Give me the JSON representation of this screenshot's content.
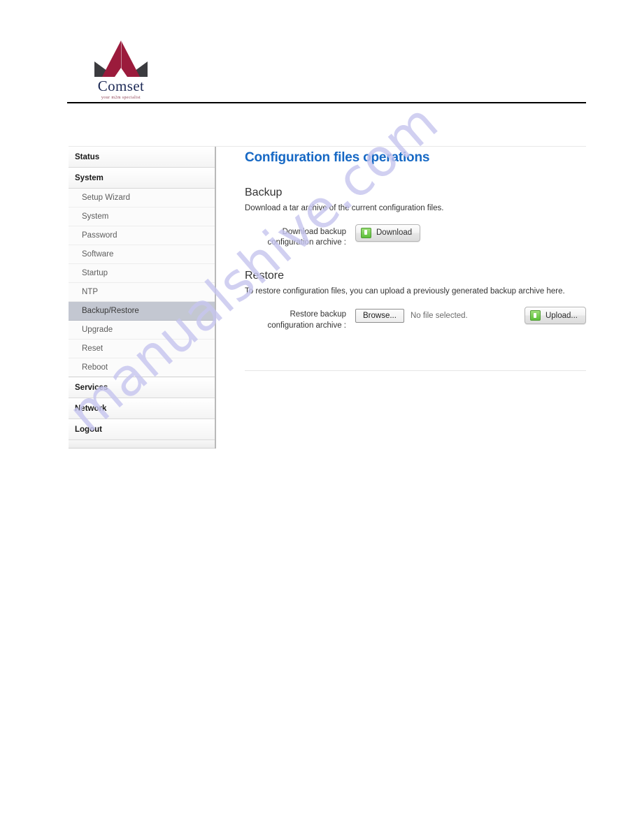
{
  "brand": {
    "wordmark": "Comset",
    "tagline": "your m2m specialist",
    "logo_icon": "comset-pyramid-logo"
  },
  "watermark": {
    "text": "manualshive.com",
    "color": "#c7c6ef"
  },
  "sidebar": {
    "groups": [
      {
        "label": "Status",
        "items": []
      },
      {
        "label": "System",
        "items": [
          {
            "label": "Setup Wizard",
            "active": false
          },
          {
            "label": "System",
            "active": false
          },
          {
            "label": "Password",
            "active": false
          },
          {
            "label": "Software",
            "active": false
          },
          {
            "label": "Startup",
            "active": false
          },
          {
            "label": "NTP",
            "active": false
          },
          {
            "label": "Backup/Restore",
            "active": true
          },
          {
            "label": "Upgrade",
            "active": false
          },
          {
            "label": "Reset",
            "active": false
          },
          {
            "label": "Reboot",
            "active": false
          }
        ]
      },
      {
        "label": "Services",
        "items": []
      },
      {
        "label": "Network",
        "items": []
      },
      {
        "label": "Logout",
        "items": []
      }
    ]
  },
  "content": {
    "title": "Configuration files operations",
    "title_color": "#1668c4",
    "backup": {
      "heading": "Backup",
      "description": "Download a tar archive of the current configuration files.",
      "field_label": "Download backup configuration archive :",
      "button_label": "Download",
      "button_icon": "download-green-icon"
    },
    "restore": {
      "heading": "Restore",
      "description": "To restore configuration files, you can upload a previously generated backup archive here.",
      "field_label": "Restore backup configuration archive :",
      "browse_label": "Browse...",
      "file_status": "No file selected.",
      "upload_label": "Upload...",
      "upload_icon": "upload-green-icon"
    }
  }
}
